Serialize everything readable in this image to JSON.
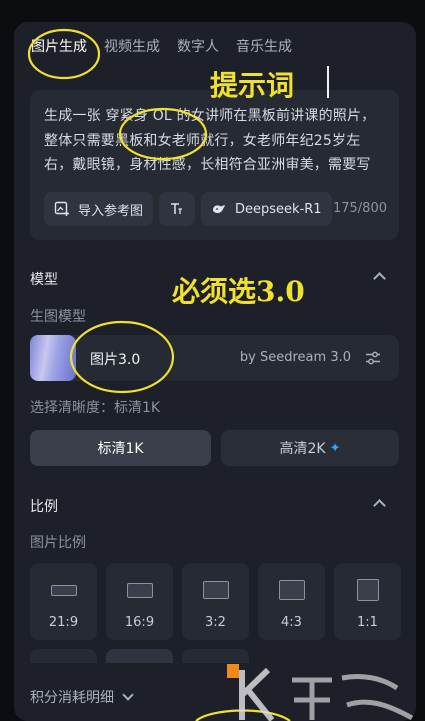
{
  "tabs": [
    {
      "label": "图片生成",
      "active": true
    },
    {
      "label": "视频生成",
      "active": false
    },
    {
      "label": "数字人",
      "active": false
    },
    {
      "label": "音乐生成",
      "active": false
    }
  ],
  "prompt": {
    "text": "生成一张 穿紧身 OL 的女讲师在黑板前讲课的照片，整体只需要黑板和女老师就行，女老师年纪25岁左右，戴眼镜，身材性感，长相符合亚洲审美，需要写实风格，参考日本电影，黑板上写着",
    "tools": {
      "import_ref": "导入参考图",
      "model": "Deepseek-R1"
    },
    "counter": "175/800"
  },
  "model_section": {
    "title": "模型",
    "sub_label": "生图模型",
    "model_name": "图片3.0",
    "model_by": "by Seedream 3.0"
  },
  "resolution": {
    "label": "选择清晰度：标清1K",
    "options": [
      {
        "label": "标清1K",
        "selected": true
      },
      {
        "label": "高清2K",
        "selected": false,
        "badge": "✦"
      }
    ]
  },
  "ratio_section": {
    "title": "比例",
    "sub_label": "图片比例",
    "options": [
      "21:9",
      "16:9",
      "3:2",
      "4:3",
      "1:1"
    ]
  },
  "cost": {
    "label": "积分消耗明细"
  },
  "annotations": {
    "prompt_word": "提示词",
    "must_select": "必须选3.0",
    "color": "#f1e12f"
  },
  "colors": {
    "panel_bg": "#1d2028",
    "card_bg": "#262a33",
    "accent_badge": "#2ea8ff"
  }
}
